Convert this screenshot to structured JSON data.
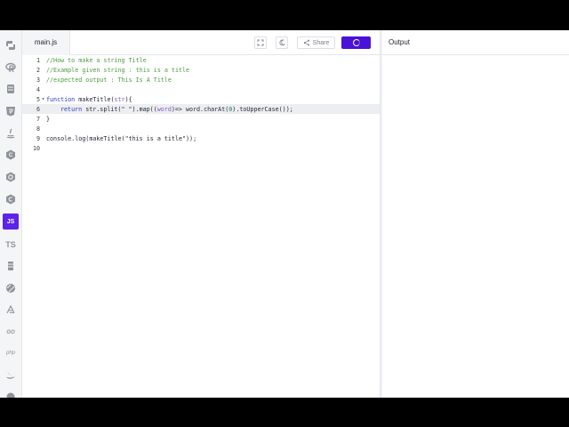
{
  "editor": {
    "file_tab": "main.js",
    "share_label": "Share",
    "code_lines": [
      {
        "num": "1",
        "fold": ""
      },
      {
        "num": "2",
        "fold": ""
      },
      {
        "num": "3",
        "fold": ""
      },
      {
        "num": "4",
        "fold": ""
      },
      {
        "num": "5",
        "fold": "▾"
      },
      {
        "num": "6",
        "fold": ""
      },
      {
        "num": "7",
        "fold": ""
      },
      {
        "num": "8",
        "fold": ""
      },
      {
        "num": "9",
        "fold": ""
      },
      {
        "num": "10",
        "fold": ""
      }
    ],
    "code": {
      "l1": "//How to make a string Title",
      "l2": "//Example given string : this is a title",
      "l3": "//expected output : This Is A Title",
      "l5_kw": "function",
      "l5_name": " makeTitle(",
      "l5_param": "str",
      "l5_end": "){",
      "l6_kw": "return",
      "l6_a": " str.split(\" \").map((",
      "l6_param": "word",
      "l6_b": ")=> word.charAt(",
      "l6_num": "0",
      "l6_c": ").toUpperCase());",
      "l7": "}",
      "l9": "console.log(makeTitle(\"this is a title\"));"
    }
  },
  "output": {
    "title": "Output",
    "text": ""
  },
  "sidebar": {
    "active_label": "JS",
    "ts_label": "TS",
    "php_label": "php"
  },
  "colors": {
    "accent": "#4a12d6",
    "comment": "#4d9d3f",
    "keyword": "#2a3db8",
    "param": "#8a57c8"
  }
}
